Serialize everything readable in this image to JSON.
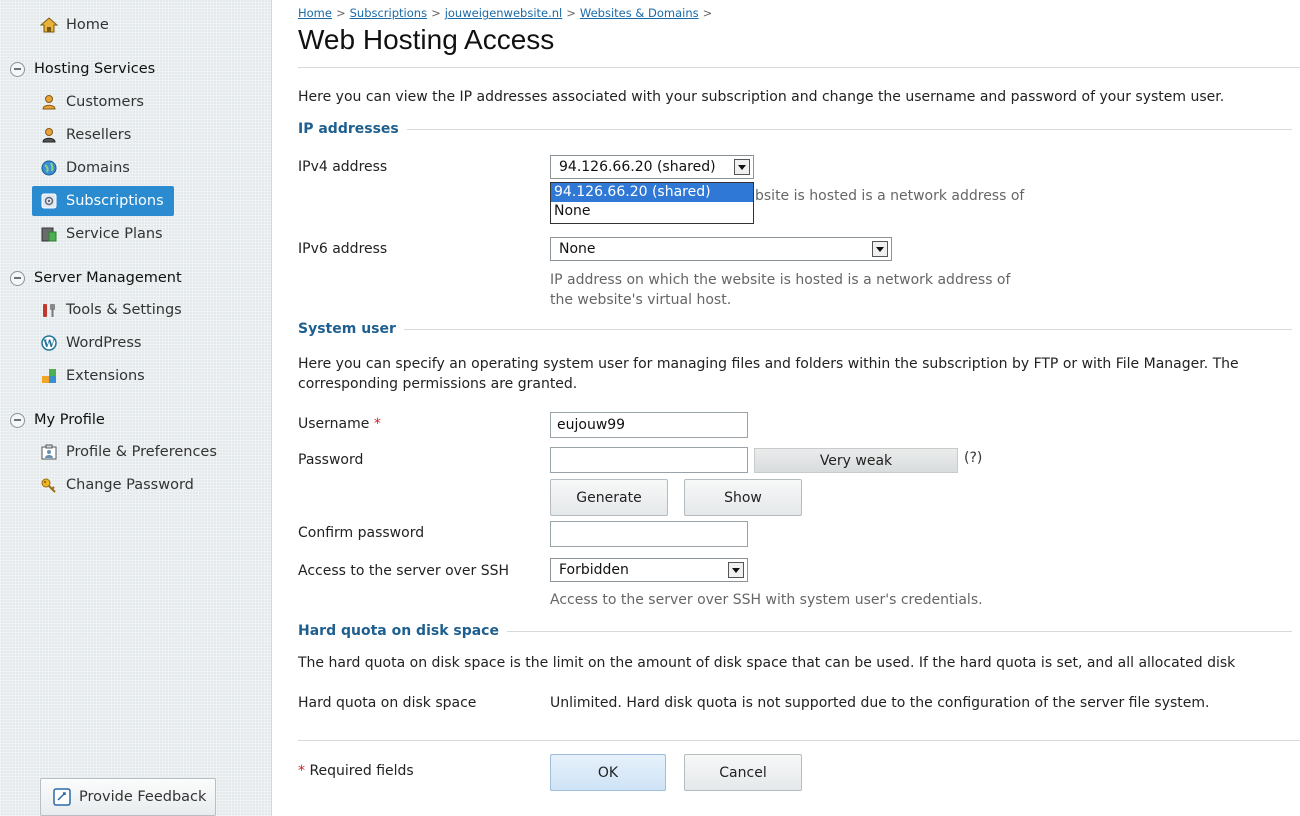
{
  "sidebar": {
    "home": "Home",
    "groups": {
      "hosting": "Hosting Services",
      "server": "Server Management",
      "profile": "My Profile"
    },
    "items": {
      "customers": "Customers",
      "resellers": "Resellers",
      "domains": "Domains",
      "subscriptions": "Subscriptions",
      "service_plans": "Service Plans",
      "tools": "Tools & Settings",
      "wordpress": "WordPress",
      "extensions": "Extensions",
      "prefs": "Profile & Preferences",
      "change_password": "Change Password"
    },
    "feedback": "Provide Feedback",
    "active_color": "#2a8bd0"
  },
  "breadcrumb": {
    "home": "Home",
    "subscriptions": "Subscriptions",
    "site": "jouweigenwebsite.nl",
    "websites": "Websites & Domains",
    "sep": ">"
  },
  "page": {
    "title": "Web Hosting Access",
    "intro": "Here you can view the IP addresses associated with your subscription and change the username and password of your system user."
  },
  "ip": {
    "section": "IP addresses",
    "ipv4_label": "IPv4 address",
    "ipv4_value": "94.126.66.20 (shared)",
    "ipv4_options": [
      "94.126.66.20 (shared)",
      "None"
    ],
    "ipv4_hint_visible": "bsite is hosted is a network address of",
    "ipv6_label": "IPv6 address",
    "ipv6_value": "None",
    "ipv6_hint_1": "IP address on which the website is hosted is a network address of",
    "ipv6_hint_2": "the website's virtual host."
  },
  "system_user": {
    "section": "System user",
    "desc_1": "Here you can specify an operating system user for managing files and folders within the subscription by FTP or with File Manager. The",
    "desc_2": "corresponding permissions are granted.",
    "username_label": "Username",
    "required_mark": "*",
    "username_value": "eujouw99",
    "password_label": "Password",
    "password_value": "",
    "strength": "Very weak",
    "help": "(?)",
    "generate": "Generate",
    "show": "Show",
    "confirm_label": "Confirm password",
    "confirm_value": "",
    "ssh_label": "Access to the server over SSH",
    "ssh_value": "Forbidden",
    "ssh_hint": "Access to the server over SSH with system user's credentials."
  },
  "quota": {
    "section": "Hard quota on disk space",
    "desc": "The hard quota on disk space is the limit on the amount of disk space that can be used. If the hard quota is set, and all allocated disk",
    "label": "Hard quota on disk space",
    "value": "Unlimited. Hard disk quota is not supported due to the configuration of the server file system."
  },
  "footer": {
    "required": "* Required fields",
    "ok": "OK",
    "cancel": "Cancel"
  }
}
